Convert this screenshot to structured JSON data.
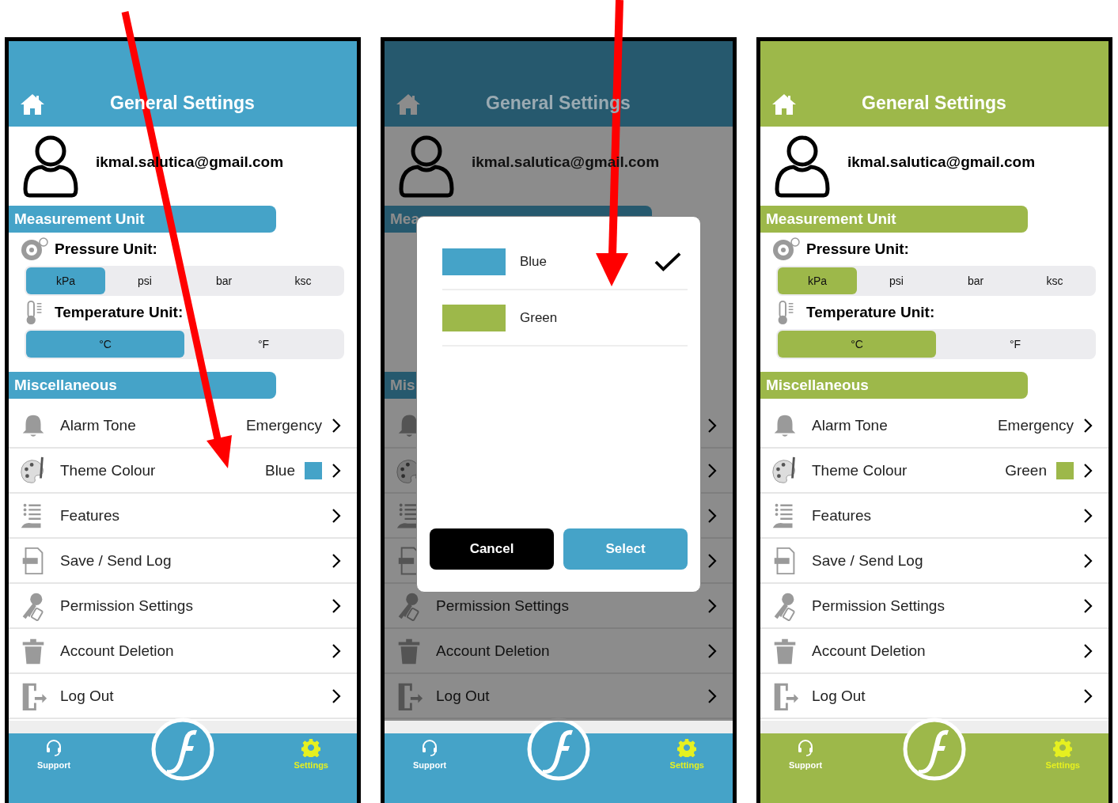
{
  "screens": [
    {
      "color": "#45a3c8",
      "title": "General Settings",
      "email": "ikmal.salutica@gmail.com",
      "measurement": {
        "title": "Measurement Unit",
        "pressure_label": "Pressure Unit:",
        "pressure_units": [
          {
            "label": "kPa",
            "selected": true
          },
          {
            "label": "psi",
            "selected": false
          },
          {
            "label": "bar",
            "selected": false
          },
          {
            "label": "ksc",
            "selected": false
          }
        ],
        "temperature_label": "Temperature Unit:",
        "temperature_units": [
          {
            "label": "°C",
            "selected": true
          },
          {
            "label": "°F",
            "selected": false
          }
        ]
      },
      "misc": {
        "title": "Miscellaneous",
        "rows": [
          {
            "kind": "alarm",
            "label": "Alarm Tone",
            "value": "Emergency"
          },
          {
            "kind": "theme",
            "label": "Theme Colour",
            "value": "Blue",
            "color": "#45a3c8"
          },
          {
            "kind": "features",
            "label": "Features"
          },
          {
            "kind": "log",
            "label": "Save / Send Log"
          },
          {
            "kind": "permission",
            "label": "Permission Settings"
          },
          {
            "kind": "delete",
            "label": "Account Deletion"
          },
          {
            "kind": "logout",
            "label": "Log Out"
          }
        ]
      },
      "nav": [
        {
          "kind": "support",
          "label": "Support",
          "selected": false
        },
        {
          "kind": "settings",
          "label": "Settings",
          "selected": true
        }
      ]
    },
    {
      "color": "#45a3c8",
      "title": "General Settings",
      "email": "ikmal.salutica@gmail.com",
      "measurement": {
        "title": "Mea"
      },
      "misc": {
        "title": "Mis",
        "rows": [
          {
            "kind": "alarm"
          },
          {
            "kind": "theme"
          },
          {
            "kind": "features"
          },
          {
            "kind": "log"
          },
          {
            "kind": "permission",
            "label": "Permission Settings"
          },
          {
            "kind": "delete",
            "label": "Account Deletion"
          },
          {
            "kind": "logout",
            "label": "Log Out"
          }
        ]
      },
      "nav": [
        {
          "kind": "support",
          "label": "Support",
          "selected": false
        },
        {
          "kind": "settings",
          "label": "Settings",
          "selected": true
        }
      ],
      "dialog": {
        "options": [
          {
            "label": "Blue",
            "color": "#45a3c8",
            "selected": true
          },
          {
            "label": "Green",
            "color": "#9db84a",
            "selected": false
          }
        ],
        "buttons": [
          {
            "kind": "cancel",
            "label": "Cancel"
          },
          {
            "kind": "select",
            "label": "Select"
          }
        ]
      }
    },
    {
      "color": "#9db84a",
      "title": "General Settings",
      "email": "ikmal.salutica@gmail.com",
      "measurement": {
        "title": "Measurement Unit",
        "pressure_label": "Pressure Unit:",
        "pressure_units": [
          {
            "label": "kPa",
            "selected": true
          },
          {
            "label": "psi",
            "selected": false
          },
          {
            "label": "bar",
            "selected": false
          },
          {
            "label": "ksc",
            "selected": false
          }
        ],
        "temperature_label": "Temperature Unit:",
        "temperature_units": [
          {
            "label": "°C",
            "selected": true
          },
          {
            "label": "°F",
            "selected": false
          }
        ]
      },
      "misc": {
        "title": "Miscellaneous",
        "rows": [
          {
            "kind": "alarm",
            "label": "Alarm Tone",
            "value": "Emergency"
          },
          {
            "kind": "theme",
            "label": "Theme Colour",
            "value": "Green",
            "color": "#9db84a"
          },
          {
            "kind": "features",
            "label": "Features"
          },
          {
            "kind": "log",
            "label": "Save / Send Log"
          },
          {
            "kind": "permission",
            "label": "Permission Settings"
          },
          {
            "kind": "delete",
            "label": "Account Deletion"
          },
          {
            "kind": "logout",
            "label": "Log Out"
          }
        ]
      },
      "nav": [
        {
          "kind": "support",
          "label": "Support",
          "selected": false
        },
        {
          "kind": "settings",
          "label": "Settings",
          "selected": true
        }
      ]
    }
  ]
}
